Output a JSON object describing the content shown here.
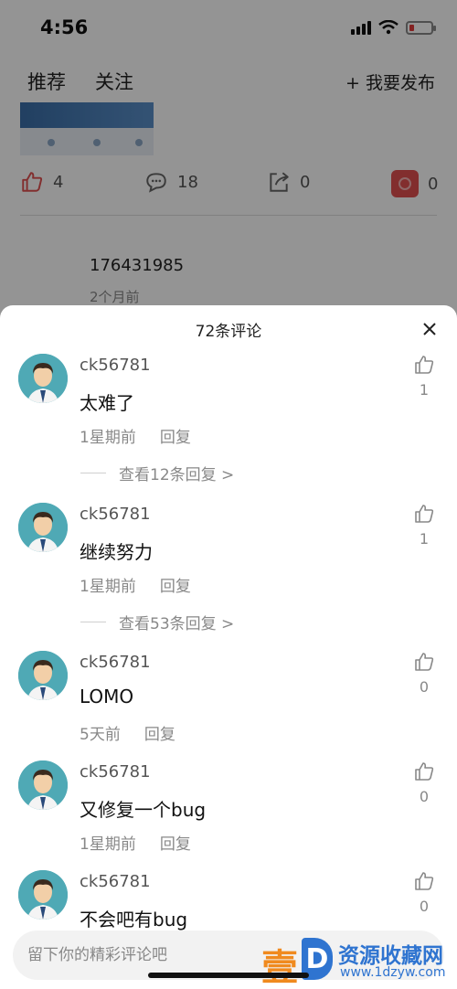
{
  "status_bar": {
    "time": "4:56"
  },
  "feed": {
    "tabs": [
      "推荐",
      "关注"
    ],
    "publish_label": "+ 我要发布",
    "actions": {
      "likes": "4",
      "comments": "18",
      "shares": "0",
      "app_count": "0"
    },
    "post_user": "176431985",
    "post_time": "2个月前"
  },
  "sheet": {
    "title": "72条评论",
    "comments": [
      {
        "user": "ck56781",
        "text": "太难了",
        "time": "1星期前",
        "reply_label": "回复",
        "likes": "1",
        "view_replies": "查看12条回复 >"
      },
      {
        "user": "ck56781",
        "text": "继续努力",
        "time": "1星期前",
        "reply_label": "回复",
        "likes": "1",
        "view_replies": "查看53条回复 >"
      },
      {
        "user": "ck56781",
        "text": "LOMO",
        "time": "5天前",
        "reply_label": "回复",
        "likes": "0"
      },
      {
        "user": "ck56781",
        "text": "又修复一个bug",
        "time": "1星期前",
        "reply_label": "回复",
        "likes": "0"
      },
      {
        "user": "ck56781",
        "text": "不会吧有bug",
        "likes": "0"
      }
    ],
    "input_placeholder": "留下你的精彩评论吧"
  },
  "watermark": {
    "logo_char": "壹",
    "d_char": "D",
    "name": "资源收藏网",
    "url": "www.1dzyw.com"
  },
  "colors": {
    "accent_red": "#e05050",
    "avatar_bg": "#4fa9b5",
    "watermark_blue": "#2f74d0",
    "watermark_orange": "#f08a1e"
  }
}
